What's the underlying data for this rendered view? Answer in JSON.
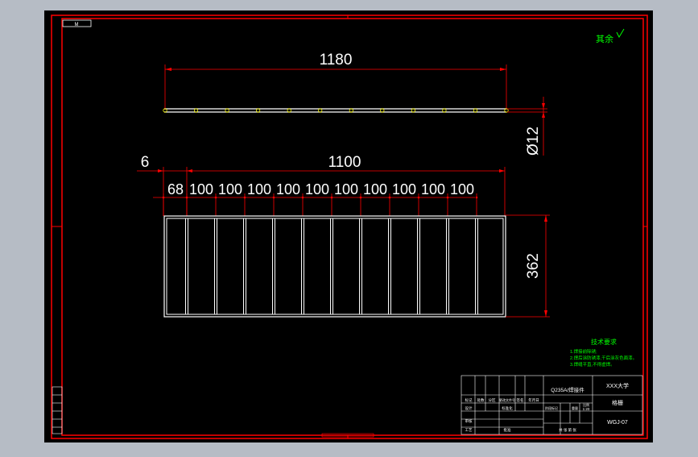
{
  "title_tag": "M",
  "watermark": "其余",
  "top_view": {
    "length_label": "1180",
    "diameter_label": "Ø12"
  },
  "front_view": {
    "offset_label": "6",
    "overall_label": "1100",
    "first_label": "68",
    "pitch_labels": [
      "100",
      "100",
      "100",
      "100",
      "100",
      "100",
      "100",
      "100",
      "100",
      "100"
    ],
    "height_label": "362"
  },
  "tech_requirements": {
    "heading": "技术要求",
    "lines": [
      "1.焊接前除锈;",
      "2.焊后涂防锈漆,干后涂灰色面漆。",
      "3.焊缝平直,不得虚焊。"
    ]
  },
  "title_block": {
    "material": "Q235A/焊接件",
    "school": "XXX大学",
    "part_name": "格栅",
    "drawing_no": "WGJ-07",
    "scale": "1:20",
    "labels": [
      "标记",
      "处数",
      "分区",
      "更改文件号",
      "签名",
      "年月日",
      "设计",
      "标准化",
      "阶段标记",
      "重量",
      "比例",
      "审核",
      "工艺",
      "批准",
      "共 张 第 张"
    ]
  },
  "colors": {
    "background": "#000000",
    "frame": "#ff0000",
    "part": "#ffffff",
    "text": "#ffffff",
    "green": "#00ff00",
    "yellow": "#ffff00"
  }
}
